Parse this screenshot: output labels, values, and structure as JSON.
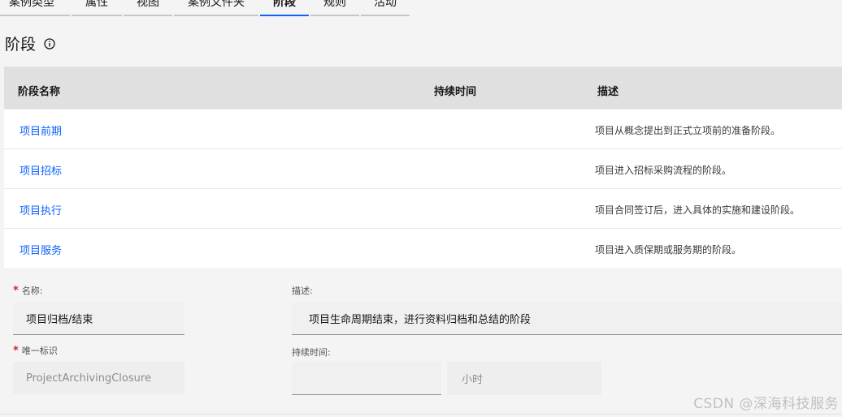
{
  "tabs": [
    {
      "label": "案例类型",
      "active": false
    },
    {
      "label": "属性",
      "active": false
    },
    {
      "label": "视图",
      "active": false
    },
    {
      "label": "案例文件夹",
      "active": false
    },
    {
      "label": "阶段",
      "active": true
    },
    {
      "label": "规则",
      "active": false
    },
    {
      "label": "活动",
      "active": false
    }
  ],
  "page": {
    "title": "阶段",
    "info_icon": "info-circle-icon"
  },
  "table": {
    "headers": {
      "name": "阶段名称",
      "duration": "持续时间",
      "description": "描述"
    },
    "rows": [
      {
        "name": "项目前期",
        "duration": "",
        "description": "项目从概念提出到正式立项前的准备阶段。"
      },
      {
        "name": "项目招标",
        "duration": "",
        "description": "项目进入招标采购流程的阶段。"
      },
      {
        "name": "项目执行",
        "duration": "",
        "description": "项目合同签订后，进入具体的实施和建设阶段。"
      },
      {
        "name": "项目服务",
        "duration": "",
        "description": "项目进入质保期或服务期的阶段。"
      }
    ]
  },
  "form": {
    "name_label": "名称:",
    "name_value": "项目归档/结束",
    "description_label": "描述:",
    "description_value": "项目生命周期结束，进行资料归档和总结的阶段",
    "id_label": "唯一标识",
    "id_value": "ProjectArchivingClosure",
    "duration_label": "持续时间:",
    "duration_value": "",
    "duration_unit": "小时",
    "required_mark": "*"
  },
  "watermark": "CSDN @深海科技服务",
  "colors": {
    "accent": "#0f62fe",
    "required": "#da1e28",
    "header_bg": "#e0e0e0"
  }
}
